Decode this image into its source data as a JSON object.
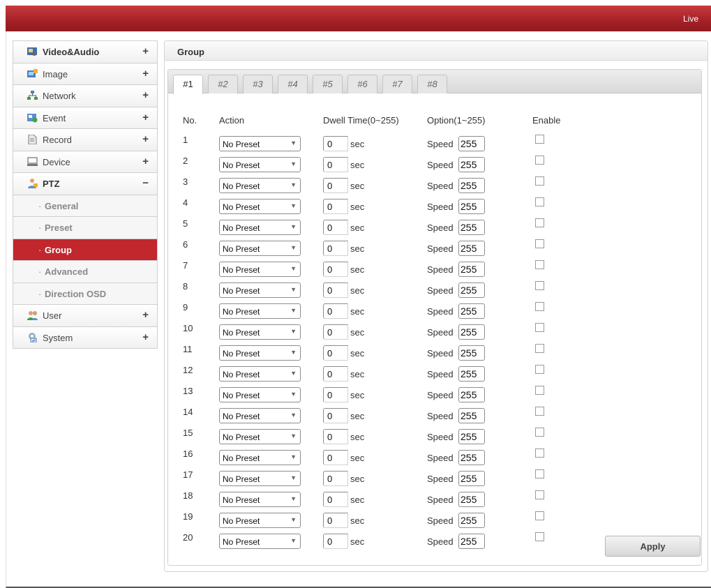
{
  "header": {
    "live_label": "Live"
  },
  "sidebar": {
    "items": [
      {
        "label": "Video&Audio",
        "toggle": "+",
        "icon": "video-audio-icon",
        "bold": true
      },
      {
        "label": "Image",
        "toggle": "+",
        "icon": "image-icon",
        "bold": false
      },
      {
        "label": "Network",
        "toggle": "+",
        "icon": "network-icon",
        "bold": false
      },
      {
        "label": "Event",
        "toggle": "+",
        "icon": "event-icon",
        "bold": false
      },
      {
        "label": "Record",
        "toggle": "+",
        "icon": "record-icon",
        "bold": false
      },
      {
        "label": "Device",
        "toggle": "+",
        "icon": "device-icon",
        "bold": false
      },
      {
        "label": "PTZ",
        "toggle": "−",
        "icon": "ptz-icon",
        "bold": true
      },
      {
        "label": "User",
        "toggle": "+",
        "icon": "user-icon",
        "bold": false
      },
      {
        "label": "System",
        "toggle": "+",
        "icon": "system-icon",
        "bold": false
      }
    ],
    "ptz_sub": [
      {
        "label": "General",
        "active": false
      },
      {
        "label": "Preset",
        "active": false
      },
      {
        "label": "Group",
        "active": true
      },
      {
        "label": "Advanced",
        "active": false
      },
      {
        "label": "Direction OSD",
        "active": false
      }
    ]
  },
  "panel": {
    "title": "Group",
    "tabs": [
      "#1",
      "#2",
      "#3",
      "#4",
      "#5",
      "#6",
      "#7",
      "#8"
    ],
    "active_tab": 0,
    "columns": {
      "no": "No.",
      "action": "Action",
      "dwell": "Dwell Time(0~255)",
      "option": "Option(1~255)",
      "enable": "Enable"
    },
    "rows": [
      {
        "no": "1",
        "action": "No Preset",
        "dwell": "0",
        "unit": "sec",
        "speed_label": "Speed",
        "speed": "255",
        "enabled": false
      },
      {
        "no": "2",
        "action": "No Preset",
        "dwell": "0",
        "unit": "sec",
        "speed_label": "Speed",
        "speed": "255",
        "enabled": false
      },
      {
        "no": "3",
        "action": "No Preset",
        "dwell": "0",
        "unit": "sec",
        "speed_label": "Speed",
        "speed": "255",
        "enabled": false
      },
      {
        "no": "4",
        "action": "No Preset",
        "dwell": "0",
        "unit": "sec",
        "speed_label": "Speed",
        "speed": "255",
        "enabled": false
      },
      {
        "no": "5",
        "action": "No Preset",
        "dwell": "0",
        "unit": "sec",
        "speed_label": "Speed",
        "speed": "255",
        "enabled": false
      },
      {
        "no": "6",
        "action": "No Preset",
        "dwell": "0",
        "unit": "sec",
        "speed_label": "Speed",
        "speed": "255",
        "enabled": false
      },
      {
        "no": "7",
        "action": "No Preset",
        "dwell": "0",
        "unit": "sec",
        "speed_label": "Speed",
        "speed": "255",
        "enabled": false
      },
      {
        "no": "8",
        "action": "No Preset",
        "dwell": "0",
        "unit": "sec",
        "speed_label": "Speed",
        "speed": "255",
        "enabled": false
      },
      {
        "no": "9",
        "action": "No Preset",
        "dwell": "0",
        "unit": "sec",
        "speed_label": "Speed",
        "speed": "255",
        "enabled": false
      },
      {
        "no": "10",
        "action": "No Preset",
        "dwell": "0",
        "unit": "sec",
        "speed_label": "Speed",
        "speed": "255",
        "enabled": false
      },
      {
        "no": "11",
        "action": "No Preset",
        "dwell": "0",
        "unit": "sec",
        "speed_label": "Speed",
        "speed": "255",
        "enabled": false
      },
      {
        "no": "12",
        "action": "No Preset",
        "dwell": "0",
        "unit": "sec",
        "speed_label": "Speed",
        "speed": "255",
        "enabled": false
      },
      {
        "no": "13",
        "action": "No Preset",
        "dwell": "0",
        "unit": "sec",
        "speed_label": "Speed",
        "speed": "255",
        "enabled": false
      },
      {
        "no": "14",
        "action": "No Preset",
        "dwell": "0",
        "unit": "sec",
        "speed_label": "Speed",
        "speed": "255",
        "enabled": false
      },
      {
        "no": "15",
        "action": "No Preset",
        "dwell": "0",
        "unit": "sec",
        "speed_label": "Speed",
        "speed": "255",
        "enabled": false
      },
      {
        "no": "16",
        "action": "No Preset",
        "dwell": "0",
        "unit": "sec",
        "speed_label": "Speed",
        "speed": "255",
        "enabled": false
      },
      {
        "no": "17",
        "action": "No Preset",
        "dwell": "0",
        "unit": "sec",
        "speed_label": "Speed",
        "speed": "255",
        "enabled": false
      },
      {
        "no": "18",
        "action": "No Preset",
        "dwell": "0",
        "unit": "sec",
        "speed_label": "Speed",
        "speed": "255",
        "enabled": false
      },
      {
        "no": "19",
        "action": "No Preset",
        "dwell": "0",
        "unit": "sec",
        "speed_label": "Speed",
        "speed": "255",
        "enabled": false
      },
      {
        "no": "20",
        "action": "No Preset",
        "dwell": "0",
        "unit": "sec",
        "speed_label": "Speed",
        "speed": "255",
        "enabled": false
      }
    ],
    "apply_label": "Apply"
  },
  "colors": {
    "brand_red": "#c1272d",
    "topbar_dark": "#8f1a1f"
  }
}
